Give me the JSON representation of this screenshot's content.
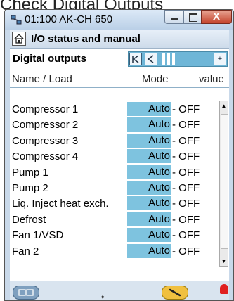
{
  "page_title": "Check Digital Outputs",
  "window": {
    "title": "01:100 AK-CH 650",
    "close_glyph": "X",
    "icons": {
      "app": "network-icon",
      "home": "home-icon"
    }
  },
  "header": {
    "title": "I/O status and manual",
    "section": "Digital outputs"
  },
  "nav": {
    "first": "|<",
    "prev": "<",
    "next": "+"
  },
  "columns": {
    "name": "Name / Load",
    "mode": "Mode",
    "value": "value"
  },
  "rows": [
    {
      "name": "Compressor 1",
      "mode": "Auto",
      "value": "- OFF"
    },
    {
      "name": "Compressor 2",
      "mode": "Auto",
      "value": "- OFF"
    },
    {
      "name": "Compressor 3",
      "mode": "Auto",
      "value": "- OFF"
    },
    {
      "name": "Compressor 4",
      "mode": "Auto",
      "value": "- OFF"
    },
    {
      "name": "Pump 1",
      "mode": "Auto",
      "value": "- OFF"
    },
    {
      "name": "Pump 2",
      "mode": "Auto",
      "value": "- OFF"
    },
    {
      "name": "Liq. Inject heat exch.",
      "mode": "Auto",
      "value": "- OFF"
    },
    {
      "name": "Defrost",
      "mode": "Auto",
      "value": "- OFF"
    },
    {
      "name": "Fan 1/VSD",
      "mode": "Auto",
      "value": "- OFF"
    },
    {
      "name": "Fan 2",
      "mode": "Auto",
      "value": "- OFF"
    }
  ],
  "scrollbar": {
    "up": "▲",
    "down": "▼"
  },
  "footer": {
    "left_icon": "device-icon",
    "right_icon": "wrench-icon",
    "alarm_icon": "bell-icon",
    "marker": "✦"
  },
  "colors": {
    "mode_cell": "#7ec3df",
    "nav_bar": "#6fb6d7",
    "close_button": "#c4432b",
    "alarm": "#e02020"
  }
}
